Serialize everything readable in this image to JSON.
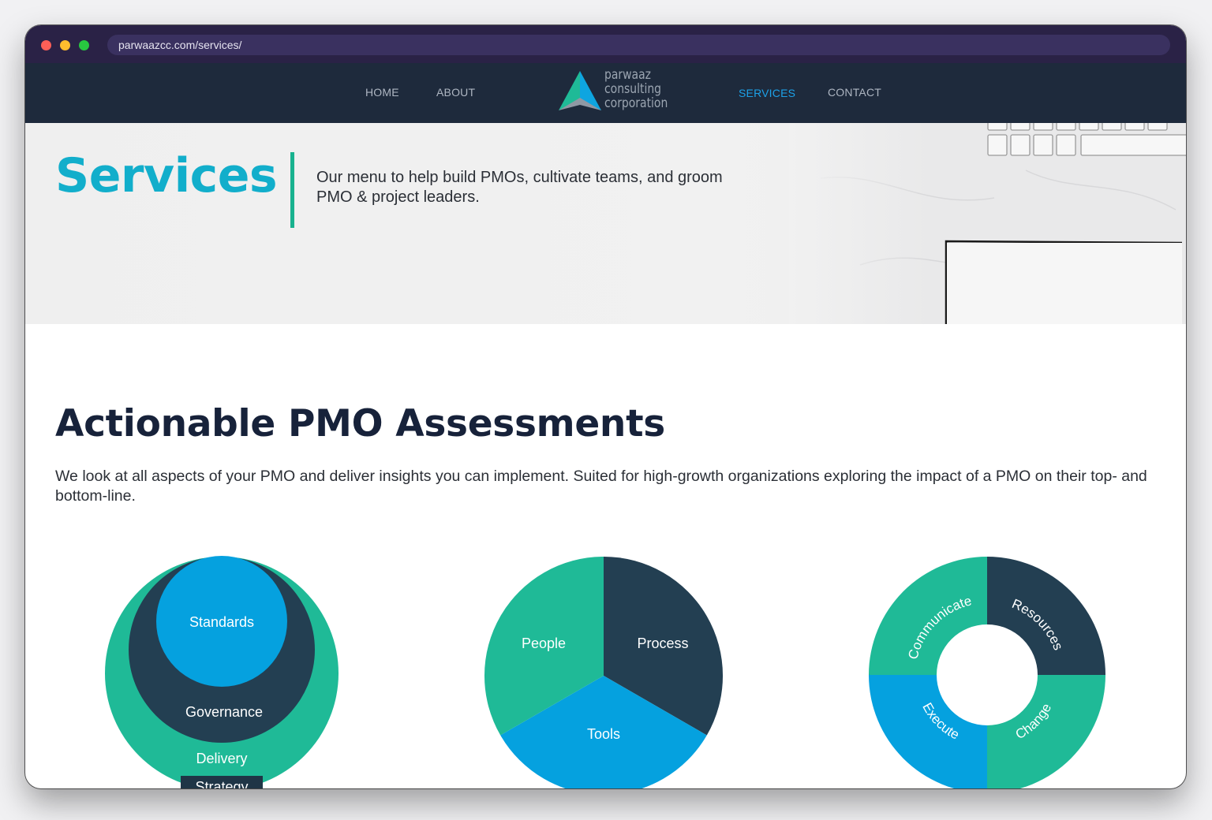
{
  "browser": {
    "url": "parwaazcc.com/services/"
  },
  "nav": {
    "home": "HOME",
    "about": "ABOUT",
    "services": "SERVICES",
    "contact": "CONTACT",
    "logo_lines": [
      "parwaaz",
      "consulting",
      "corporation"
    ],
    "active": "SERVICES"
  },
  "hero": {
    "title": "Services",
    "description": "Our menu to help build PMOs, cultivate teams, and groom PMO & project leaders."
  },
  "section": {
    "title": "Actionable PMO Assessments",
    "description": "We look at all aspects of your PMO and deliver insights you can implement. Suited for high-growth organizations exploring the impact of a PMO on their top- and bottom-line."
  },
  "diagrams": {
    "nested": {
      "standards": "Standards",
      "governance": "Governance",
      "delivery": "Delivery",
      "strategy": "Strategy"
    },
    "pie": {
      "people": "People",
      "process": "Process",
      "tools": "Tools"
    },
    "ring": {
      "communicate": "Communicate",
      "resources": "Resources",
      "execute": "Execute",
      "change": "Change"
    }
  },
  "colors": {
    "teal": "#1fba97",
    "navy": "#233f52",
    "blue": "#05a1df",
    "title_teal": "#12aecb",
    "nav_bg": "#1e2a3c",
    "active_link": "#1da1e8"
  }
}
